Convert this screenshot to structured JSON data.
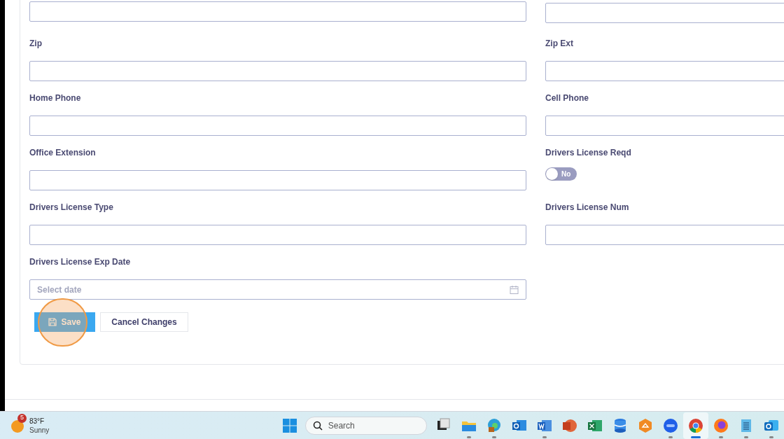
{
  "form": {
    "rows": [
      [
        {
          "kind": "text"
        },
        {
          "kind": "text"
        }
      ],
      [
        {
          "kind": "text",
          "label": "Zip"
        },
        {
          "kind": "text",
          "label": "Zip Ext"
        }
      ],
      [
        {
          "kind": "text",
          "label": "Home Phone"
        },
        {
          "kind": "text",
          "label": "Cell Phone"
        }
      ],
      [
        {
          "kind": "text",
          "label": "Office Extension"
        },
        {
          "kind": "toggle",
          "label": "Drivers License Reqd",
          "on": false,
          "text": "No"
        }
      ],
      [
        {
          "kind": "text",
          "label": "Drivers License Type"
        },
        {
          "kind": "text",
          "label": "Drivers License Num"
        }
      ],
      [
        {
          "kind": "date",
          "label": "Drivers License Exp Date",
          "placeholder": "Select date"
        }
      ]
    ],
    "buttons": [
      {
        "kind": "primary",
        "label": "Save"
      },
      {
        "kind": "secondary",
        "label": "Cancel Changes"
      }
    ]
  },
  "taskbar": {
    "weather": {
      "badge": "5",
      "temperature": "83°F",
      "condition": "Sunny"
    },
    "search": {
      "placeholder": "Search"
    },
    "apps": [
      {
        "kind": "taskview",
        "running": false,
        "active": false
      },
      {
        "kind": "folder",
        "running": true,
        "active": false
      },
      {
        "kind": "edge",
        "running": true,
        "active": false
      },
      {
        "kind": "mail",
        "running": false,
        "active": false
      },
      {
        "kind": "doc",
        "running": true,
        "active": false
      },
      {
        "kind": "slides",
        "running": false,
        "active": false
      },
      {
        "kind": "sheet",
        "running": false,
        "active": false
      },
      {
        "kind": "db",
        "running": false,
        "active": false
      },
      {
        "kind": "hex",
        "running": false,
        "active": false
      },
      {
        "kind": "video",
        "running": true,
        "active": false
      },
      {
        "kind": "chrome",
        "running": true,
        "active": true
      },
      {
        "kind": "firefox",
        "running": true,
        "active": false
      },
      {
        "kind": "notepad",
        "running": true,
        "active": false
      },
      {
        "kind": "mail2",
        "running": true,
        "active": false
      }
    ]
  }
}
